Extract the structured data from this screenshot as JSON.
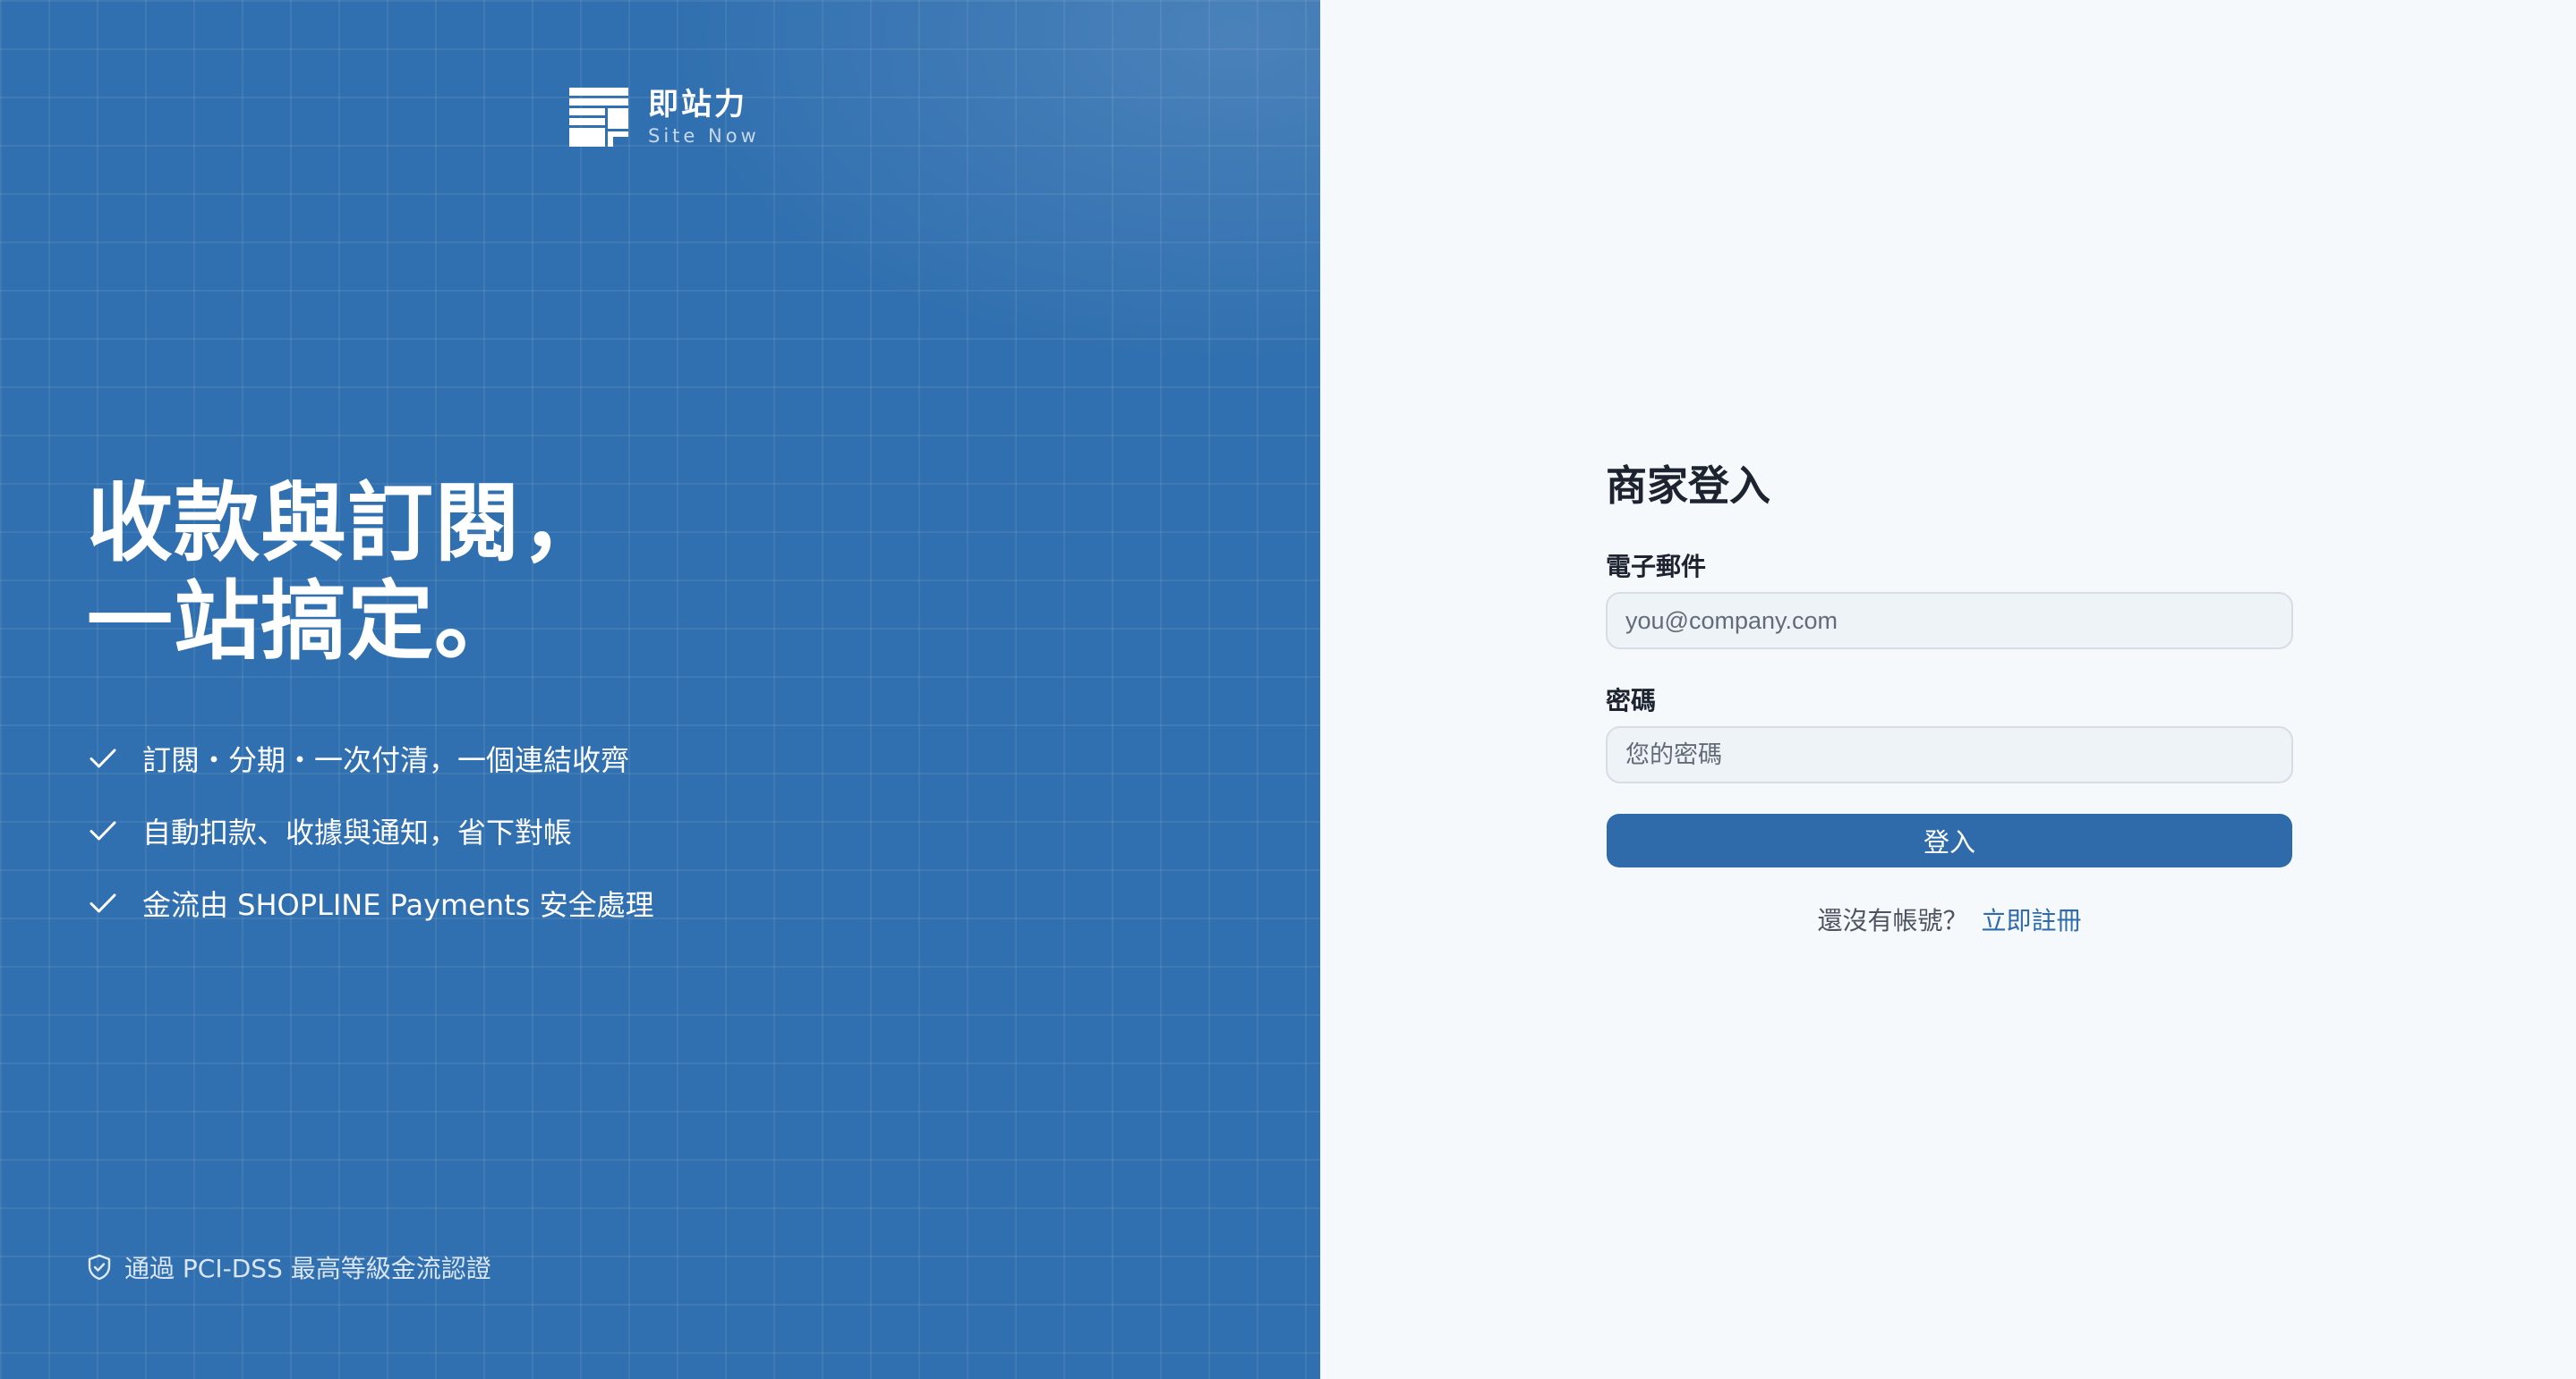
{
  "brand": {
    "name_cn": "即站力",
    "name_en": "Site Now",
    "logo_icon": "site-now-logo-icon"
  },
  "hero": {
    "headline_line1": "收款與訂閱，",
    "headline_line2": "一站搞定。",
    "features": [
      {
        "icon": "check-icon",
        "text": "訂閱・分期・一次付清，一個連結收齊"
      },
      {
        "icon": "check-icon",
        "text": "自動扣款、收據與通知，省下對帳"
      },
      {
        "icon": "check-icon",
        "text": "金流由 SHOPLINE Payments 安全處理"
      }
    ],
    "badge": {
      "icon": "shield-check-icon",
      "text": "通過 PCI-DSS 最高等級金流認證"
    }
  },
  "login": {
    "title": "商家登入",
    "email": {
      "label": "電子郵件",
      "placeholder": "you@company.com",
      "value": ""
    },
    "password": {
      "label": "密碼",
      "placeholder": "您的密碼",
      "value": ""
    },
    "submit_label": "登入",
    "signup_prompt": "還沒有帳號？",
    "signup_link": "立即註冊"
  },
  "colors": {
    "left_panel": "#3170b0",
    "right_panel": "#f6f9fc",
    "accent": "#2f6bab",
    "text_dark": "#1d2430"
  }
}
